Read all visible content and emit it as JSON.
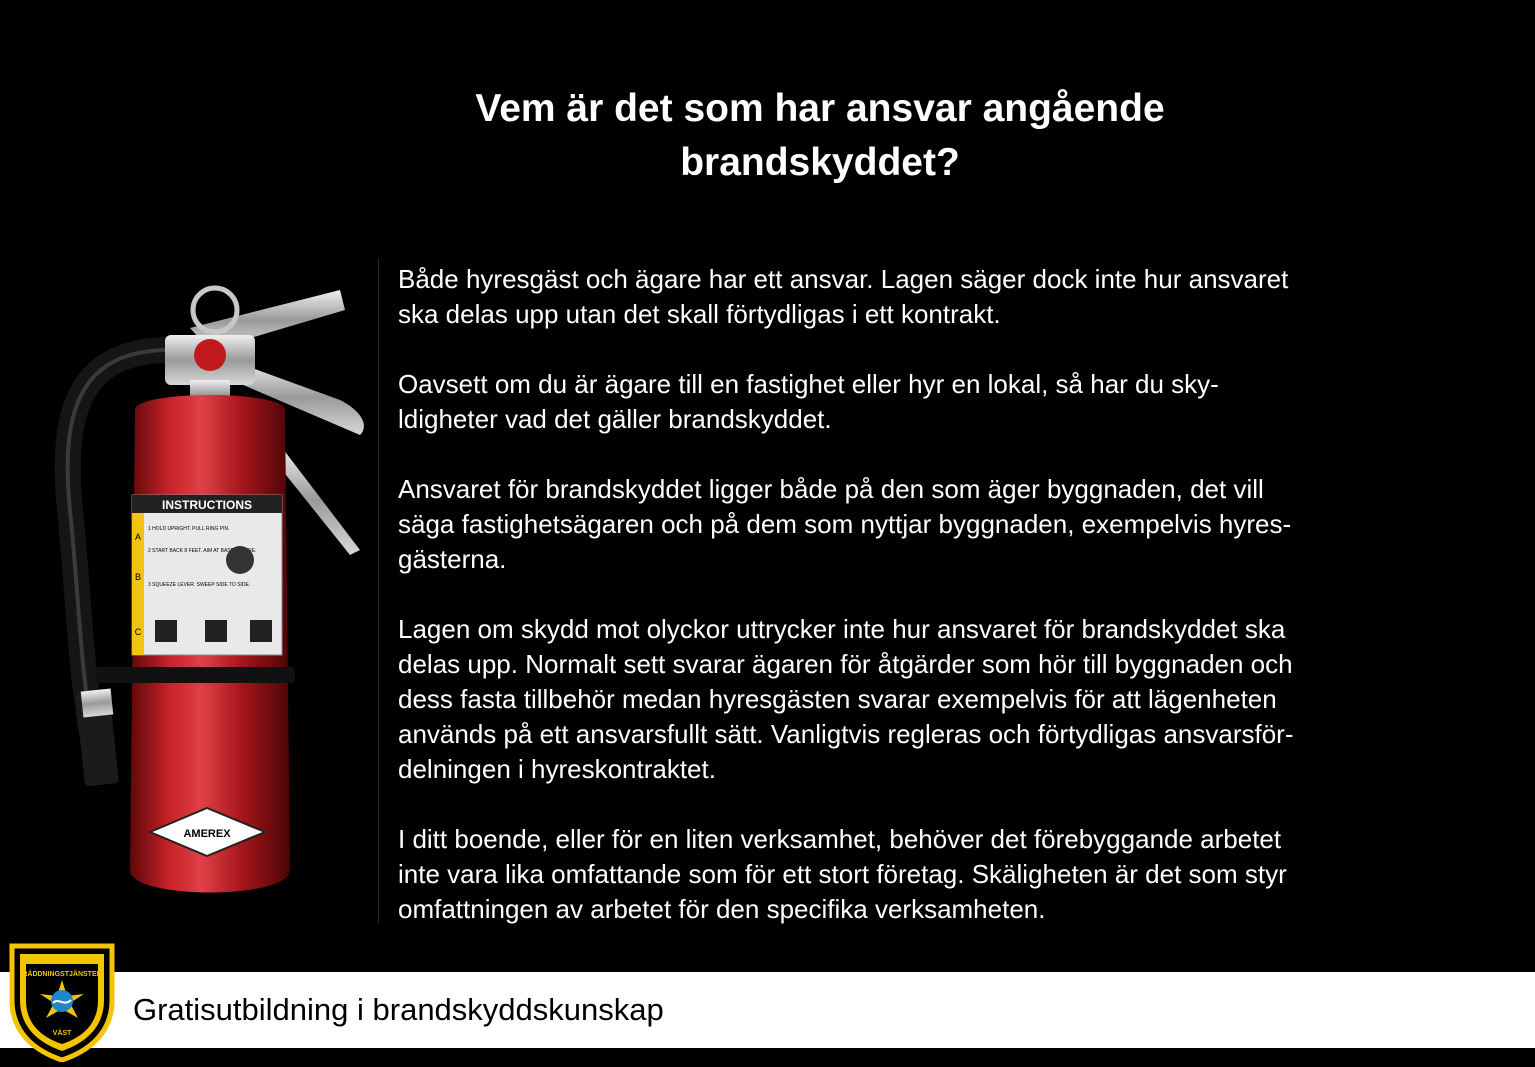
{
  "slide": {
    "title": "Vem är det som har ansvar angående\nbrandskyddet?",
    "paragraphs": [
      " Både hyresgäst och ägare har ett ansvar. Lagen säger dock inte hur ansvaret\nska delas upp utan det skall förtydligas i ett kontrakt.",
      "Oavsett om du är ägare till en fastighet eller hyr en lokal, så har du sky-\nldigheter vad det gäller brandskyddet.",
      "Ansvaret för brandskyddet ligger både på den som äger byggnaden, det vill\nsäga fastighetsägaren och på dem som nyttjar byggnaden, exempelvis hyres-\ngästerna.",
      "Lagen om skydd mot olyckor uttrycker inte hur ansvaret för brandskyddet ska\ndelas upp. Normalt sett svarar ägaren för åtgärder som hör till byggnaden och\ndess fasta tillbehör medan hyresgästen svarar exempelvis för att lägenheten\nanvänds på ett ansvarsfullt sätt. Vanligtvis regleras och förtydligas ansvarsför-\ndelningen i hyreskontraktet.",
      "I ditt boende, eller för en liten verksamhet, behöver det förebyggande arbetet\ninte vara lika omfattande som för ett stort företag. Skäligheten är det som styr\nomfattningen av arbetet för den specifika verksamheten."
    ]
  },
  "image": {
    "icon": "fire-extinguisher-icon",
    "label_heading": "INSTRUCTIONS",
    "brand": "AMEREX",
    "label_steps": [
      "1 HOLD UPRIGHT. PULL RING PIN.",
      "2 START BACK 8 FEET. AIM AT BASE OF FIRE.",
      "3 SQUEEZE LEVER. SWEEP SIDE TO SIDE."
    ],
    "label_classes": [
      "A",
      "B",
      "C"
    ]
  },
  "footer": {
    "text": "Gratisutbildning i brandskyddskunskap",
    "logo_top_text": "RÄDDNINGSTJÄNSTEN",
    "logo_bottom_text": "VÄST"
  },
  "colors": {
    "background": "#000000",
    "extinguisher_red": "#b3191c",
    "logo_yellow": "#f2c500",
    "logo_blue": "#1f86c8"
  }
}
